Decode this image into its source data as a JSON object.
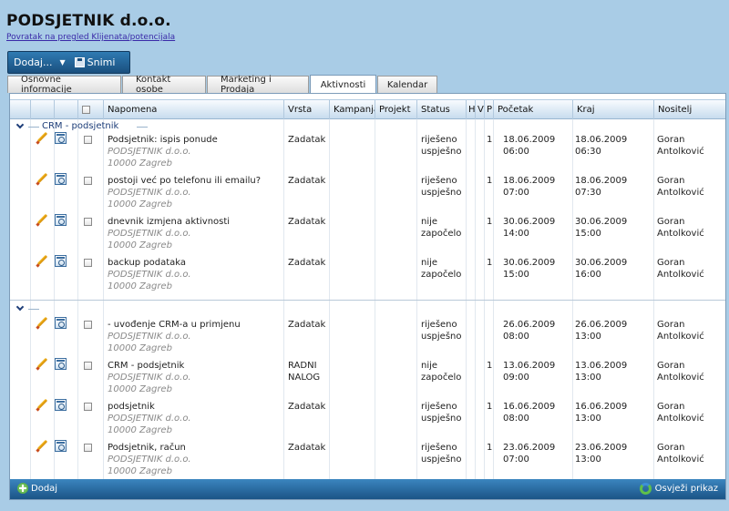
{
  "app": {
    "title": "PODSJETNIK d.o.o.",
    "back_link": "Povratak na pregled Klijenata/potencijala"
  },
  "toolbar": {
    "add_label": "Dodaj...",
    "save_label": "Snimi"
  },
  "tabs": [
    {
      "label": "Osnovne informacije",
      "active": false
    },
    {
      "label": "Kontakt osobe",
      "active": false
    },
    {
      "label": "Marketing i Prodaja",
      "active": false
    },
    {
      "label": "Aktivnosti",
      "active": true
    },
    {
      "label": "Kalendar",
      "active": false
    }
  ],
  "columns": {
    "napomena": "Napomena",
    "vrsta": "Vrsta",
    "kampanja": "Kampanja",
    "projekt": "Projekt",
    "status": "Status",
    "h": "H",
    "v": "V",
    "p": "P",
    "pocetak": "Početak",
    "kraj": "Kraj",
    "nositelj": "Nositelj"
  },
  "groups": [
    {
      "label": "CRM - podsjetnik",
      "rows": [
        {
          "napomena": "Podsjetnik: ispis ponude",
          "company": "PODSJETNIK d.o.o.",
          "city": "10000 Zagreb",
          "vrsta1": "Zadatak",
          "vrsta2": "",
          "status1": "riješeno",
          "status2": "uspješno",
          "p": "1",
          "pocetak": "18.06.2009 06:00",
          "kraj": "18.06.2009 06:30",
          "nositelj1": "Goran",
          "nositelj2": "Antolković"
        },
        {
          "napomena": "postoji već po telefonu ili emailu?",
          "company": "PODSJETNIK d.o.o.",
          "city": "10000 Zagreb",
          "vrsta1": "Zadatak",
          "vrsta2": "",
          "status1": "riješeno",
          "status2": "uspješno",
          "p": "1",
          "pocetak": "18.06.2009 07:00",
          "kraj": "18.06.2009 07:30",
          "nositelj1": "Goran",
          "nositelj2": "Antolković"
        },
        {
          "napomena": "dnevnik izmjena aktivnosti",
          "company": "PODSJETNIK d.o.o.",
          "city": "10000 Zagreb",
          "vrsta1": "Zadatak",
          "vrsta2": "",
          "status1": "nije",
          "status2": "započelo",
          "p": "1",
          "pocetak": "30.06.2009 14:00",
          "kraj": "30.06.2009 15:00",
          "nositelj1": "Goran",
          "nositelj2": "Antolković"
        },
        {
          "napomena": "backup podataka",
          "company": "PODSJETNIK d.o.o.",
          "city": "10000 Zagreb",
          "vrsta1": "Zadatak",
          "vrsta2": "",
          "status1": "nije",
          "status2": "započelo",
          "p": "1",
          "pocetak": "30.06.2009 15:00",
          "kraj": "30.06.2009 16:00",
          "nositelj1": "Goran",
          "nositelj2": "Antolković"
        }
      ]
    },
    {
      "label": "",
      "rows": [
        {
          "napomena": "- uvođenje CRM-a u primjenu",
          "company": "PODSJETNIK d.o.o.",
          "city": "10000 Zagreb",
          "vrsta1": "Zadatak",
          "vrsta2": "",
          "status1": "riješeno",
          "status2": "uspješno",
          "p": "",
          "pocetak": "26.06.2009 08:00",
          "kraj": "26.06.2009 13:00",
          "nositelj1": "Goran",
          "nositelj2": "Antolković"
        },
        {
          "napomena": "CRM - podsjetnik",
          "company": "PODSJETNIK d.o.o.",
          "city": "10000 Zagreb",
          "vrsta1": "RADNI",
          "vrsta2": "NALOG",
          "status1": "nije",
          "status2": "započelo",
          "p": "1",
          "pocetak": "13.06.2009 09:00",
          "kraj": "13.06.2009 13:00",
          "nositelj1": "Goran",
          "nositelj2": "Antolković"
        },
        {
          "napomena": "podsjetnik",
          "company": "PODSJETNIK d.o.o.",
          "city": "10000 Zagreb",
          "vrsta1": "Zadatak",
          "vrsta2": "",
          "status1": "riješeno",
          "status2": "uspješno",
          "p": "1",
          "pocetak": "16.06.2009 08:00",
          "kraj": "16.06.2009 13:00",
          "nositelj1": "Goran",
          "nositelj2": "Antolković"
        },
        {
          "napomena": "Podsjetnik, račun",
          "company": "PODSJETNIK d.o.o.",
          "city": "10000 Zagreb",
          "vrsta1": "Zadatak",
          "vrsta2": "",
          "status1": "riješeno",
          "status2": "uspješno",
          "p": "1",
          "pocetak": "23.06.2009 07:00",
          "kraj": "23.06.2009 13:00",
          "nositelj1": "Goran",
          "nositelj2": "Antolković"
        }
      ]
    }
  ],
  "footer": {
    "add_label": "Dodaj",
    "refresh_label": "Osvježi prikaz"
  }
}
